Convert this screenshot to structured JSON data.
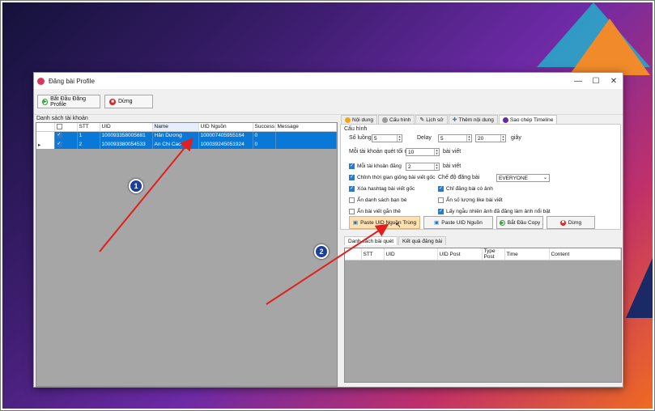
{
  "window": {
    "title": "Đăng bài Profile",
    "minimize": "—",
    "maximize": "☐",
    "close": "✕"
  },
  "toolbar": {
    "start_label": "Bắt Đầu Đăng Profile",
    "stop_label": "Dừng"
  },
  "accounts": {
    "section_label": "Danh sách tài khoản",
    "columns": [
      "",
      "STT",
      "UID",
      "Name",
      "UID Nguồn",
      "Success",
      "Message"
    ],
    "rows": [
      {
        "stt": "1",
        "uid": "100093358005681",
        "name": "Hân Dương",
        "uid_source": "100007405955164",
        "success": "0",
        "message": ""
      },
      {
        "stt": "2",
        "uid": "100093380054533",
        "name": "An Chi Cao",
        "uid_source": "100039245051924",
        "success": "0",
        "message": ""
      }
    ]
  },
  "tabs": [
    "Nội dung",
    "Cấu hình",
    "Lịch sử",
    "Thêm nội dung",
    "Sao chép Timeline"
  ],
  "config": {
    "group_label": "Cấu hình",
    "threads_label": "Số luồng",
    "threads_value": "5",
    "delay_label": "Delay",
    "delay_from": "5",
    "delay_to": "20",
    "delay_unit": "giây",
    "scan_label": "Mỗi tài khoản quét tối đa",
    "scan_value": "10",
    "scan_unit": "bài viết",
    "post_label": "Mỗi tài khoản đăng",
    "post_value": "2",
    "post_unit": "bài viết",
    "options": [
      {
        "label": "Chỉnh thời gian giống bài viết gốc",
        "checked": true
      },
      {
        "label": "Xóa hashtag bài viết gốc",
        "checked": true
      },
      {
        "label": "Ẩn danh sách bạn bè",
        "checked": false
      },
      {
        "label": "Ẩn bài viết gắn thẻ",
        "checked": false
      }
    ],
    "mode_label": "Chế độ đăng bài",
    "mode_value": "EVERYONE",
    "options_right": [
      {
        "label": "Chỉ đăng bài có ảnh",
        "checked": true
      },
      {
        "label": "Ẩn số lượng like bài viết",
        "checked": false
      },
      {
        "label": "Lấy ngẫu nhiên ảnh đã đăng làm ảnh nổi bật",
        "checked": true
      }
    ]
  },
  "actions": {
    "paste_dup": "Paste UID Nguồn Trùng",
    "paste": "Paste UID Nguồn",
    "start_copy": "Bắt Đầu Copy",
    "stop": "Dừng"
  },
  "result_tabs": [
    "Danh sách bài quét",
    "Kết quả đăng bài"
  ],
  "result_columns": [
    "",
    "STT",
    "UID",
    "UID Post",
    "Type Post",
    "Time",
    "Content"
  ],
  "badges": [
    "1",
    "2"
  ],
  "colors": {
    "selection": "#0a78d7",
    "arrow": "#e0201e",
    "badge": "#1b3f9a"
  }
}
